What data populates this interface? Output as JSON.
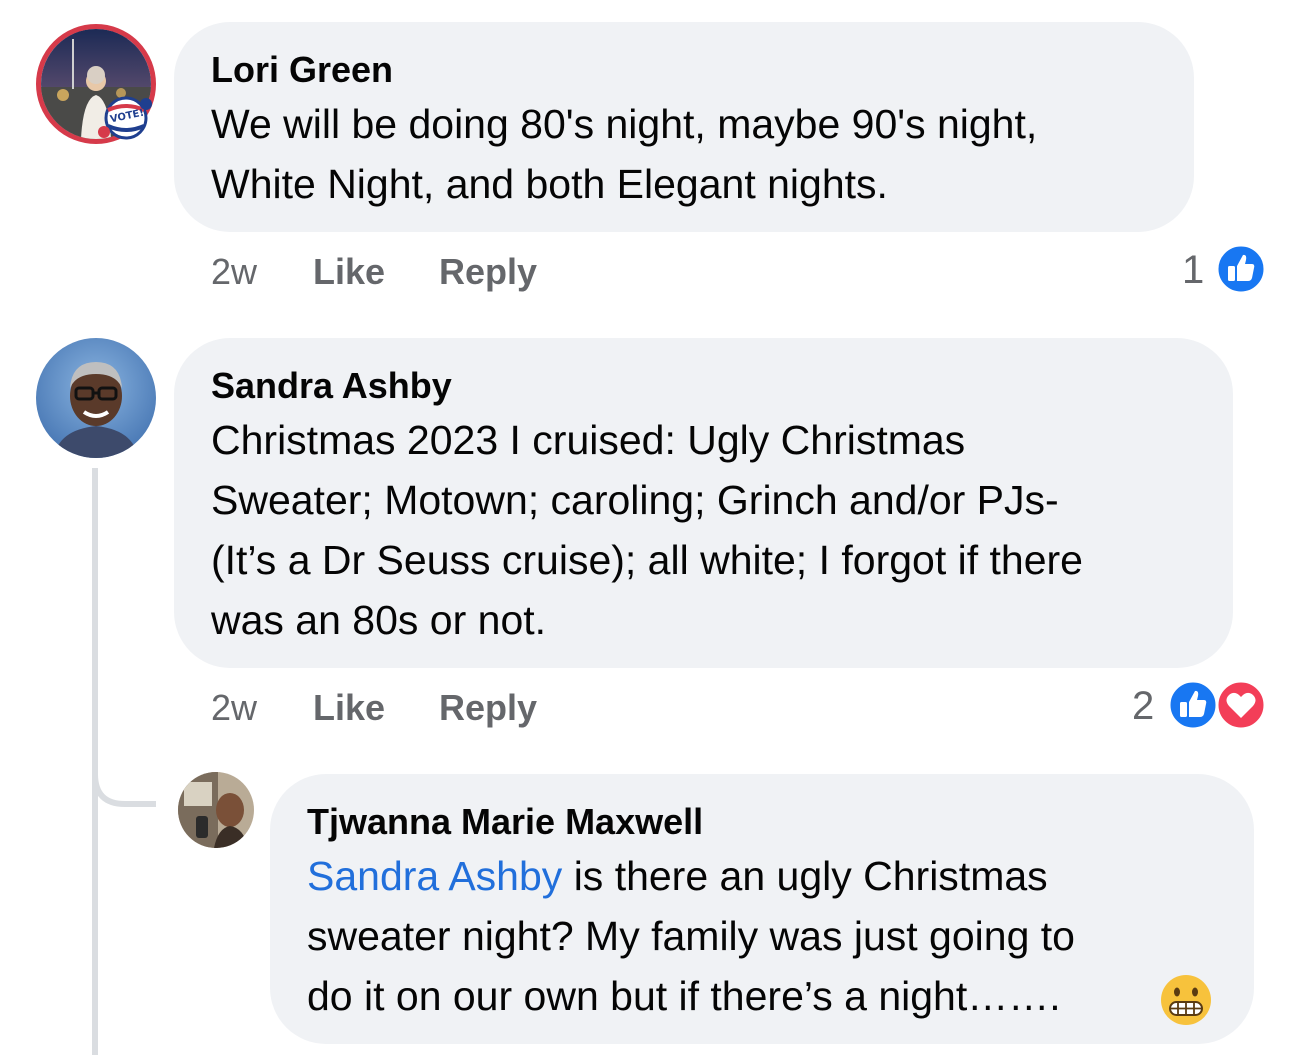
{
  "comments": [
    {
      "author": "Lori Green",
      "lines": [
        "We will be doing 80's night, maybe 90's night,",
        "White Night, and both Elegant nights."
      ],
      "time": "2w",
      "like_label": "Like",
      "reply_label": "Reply",
      "reaction_count": "1",
      "reactions": [
        "like-icon"
      ],
      "avatar_badge": "VOTE!"
    },
    {
      "author": "Sandra Ashby",
      "lines": [
        "Christmas 2023 I cruised: Ugly Christmas",
        "Sweater; Motown; caroling; Grinch and/or PJs-",
        "(It’s a Dr Seuss cruise); all white; I forgot if there",
        "was an 80s or not."
      ],
      "time": "2w",
      "like_label": "Like",
      "reply_label": "Reply",
      "reaction_count": "2",
      "reactions": [
        "like-icon",
        "love-icon"
      ]
    }
  ],
  "reply": {
    "author": "Tjwanna Marie Maxwell",
    "mention": "Sandra Ashby",
    "line1_rest": " is there an ugly Christmas",
    "line2": "sweater night? My family was just going to",
    "line3": "do it on our own but if there’s a night…….",
    "emoji": "grimacing-face-emoji"
  },
  "colors": {
    "bubble": "#f0f2f5",
    "meta_text": "#65676b",
    "like_blue": "#1877f2",
    "love_red": "#f33e58",
    "mention_blue": "#216fdb",
    "thread_line": "#dadde1"
  }
}
